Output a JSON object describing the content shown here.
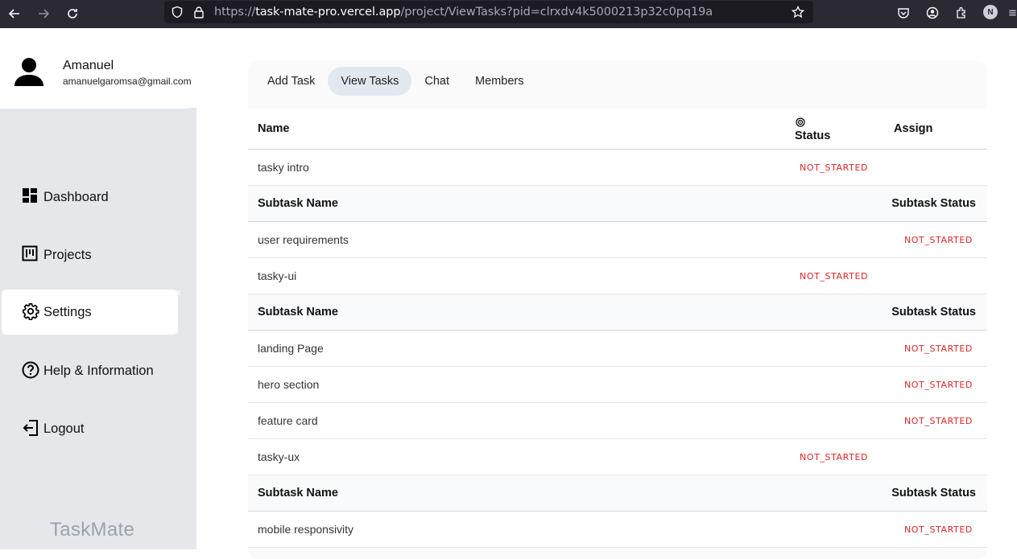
{
  "browser": {
    "url_scheme": "https://",
    "url_host": "task-mate-pro.vercel.app",
    "url_path": "/project/ViewTasks?pid=clrxdv4k5000213p32c0pq19a",
    "profile_initial": "N"
  },
  "sidebar": {
    "user_name": "Amanuel",
    "user_email": "amanuelgaromsa@gmail.com",
    "items": [
      {
        "label": "Dashboard",
        "icon": "dashboard-icon"
      },
      {
        "label": "Projects",
        "icon": "kanban-icon"
      },
      {
        "label": "Settings",
        "icon": "gear-icon"
      },
      {
        "label": "Help & Information",
        "icon": "help-circle-icon"
      },
      {
        "label": "Logout",
        "icon": "logout-icon"
      }
    ],
    "active_item": "Settings",
    "brand": "TaskMate"
  },
  "tabs": [
    "Add Task",
    "View Tasks",
    "Chat",
    "Members"
  ],
  "active_tab": "View Tasks",
  "table": {
    "headers": {
      "name": "Name",
      "status": "Status",
      "assign": "Assign"
    },
    "sub_headers": {
      "name": "Subtask Name",
      "status": "Subtask Status"
    },
    "rows": [
      {
        "type": "task",
        "name": "tasky intro",
        "status": "NOT_STARTED"
      },
      {
        "type": "subheader"
      },
      {
        "type": "subtask",
        "name": "user requirements",
        "status": "NOT_STARTED"
      },
      {
        "type": "task",
        "name": "tasky-ui",
        "status": "NOT_STARTED"
      },
      {
        "type": "subheader"
      },
      {
        "type": "subtask",
        "name": "landing Page",
        "status": "NOT_STARTED"
      },
      {
        "type": "subtask",
        "name": "hero section",
        "status": "NOT_STARTED"
      },
      {
        "type": "subtask",
        "name": "feature card",
        "status": "NOT_STARTED"
      },
      {
        "type": "task",
        "name": "tasky-ux",
        "status": "NOT_STARTED"
      },
      {
        "type": "subheader"
      },
      {
        "type": "subtask",
        "name": "mobile responsivity",
        "status": "NOT_STARTED"
      }
    ]
  },
  "colors": {
    "status_red": "#dc2626",
    "sidebar_bg": "#e5e7eb",
    "active_tab_bg": "#e2e8f0"
  }
}
